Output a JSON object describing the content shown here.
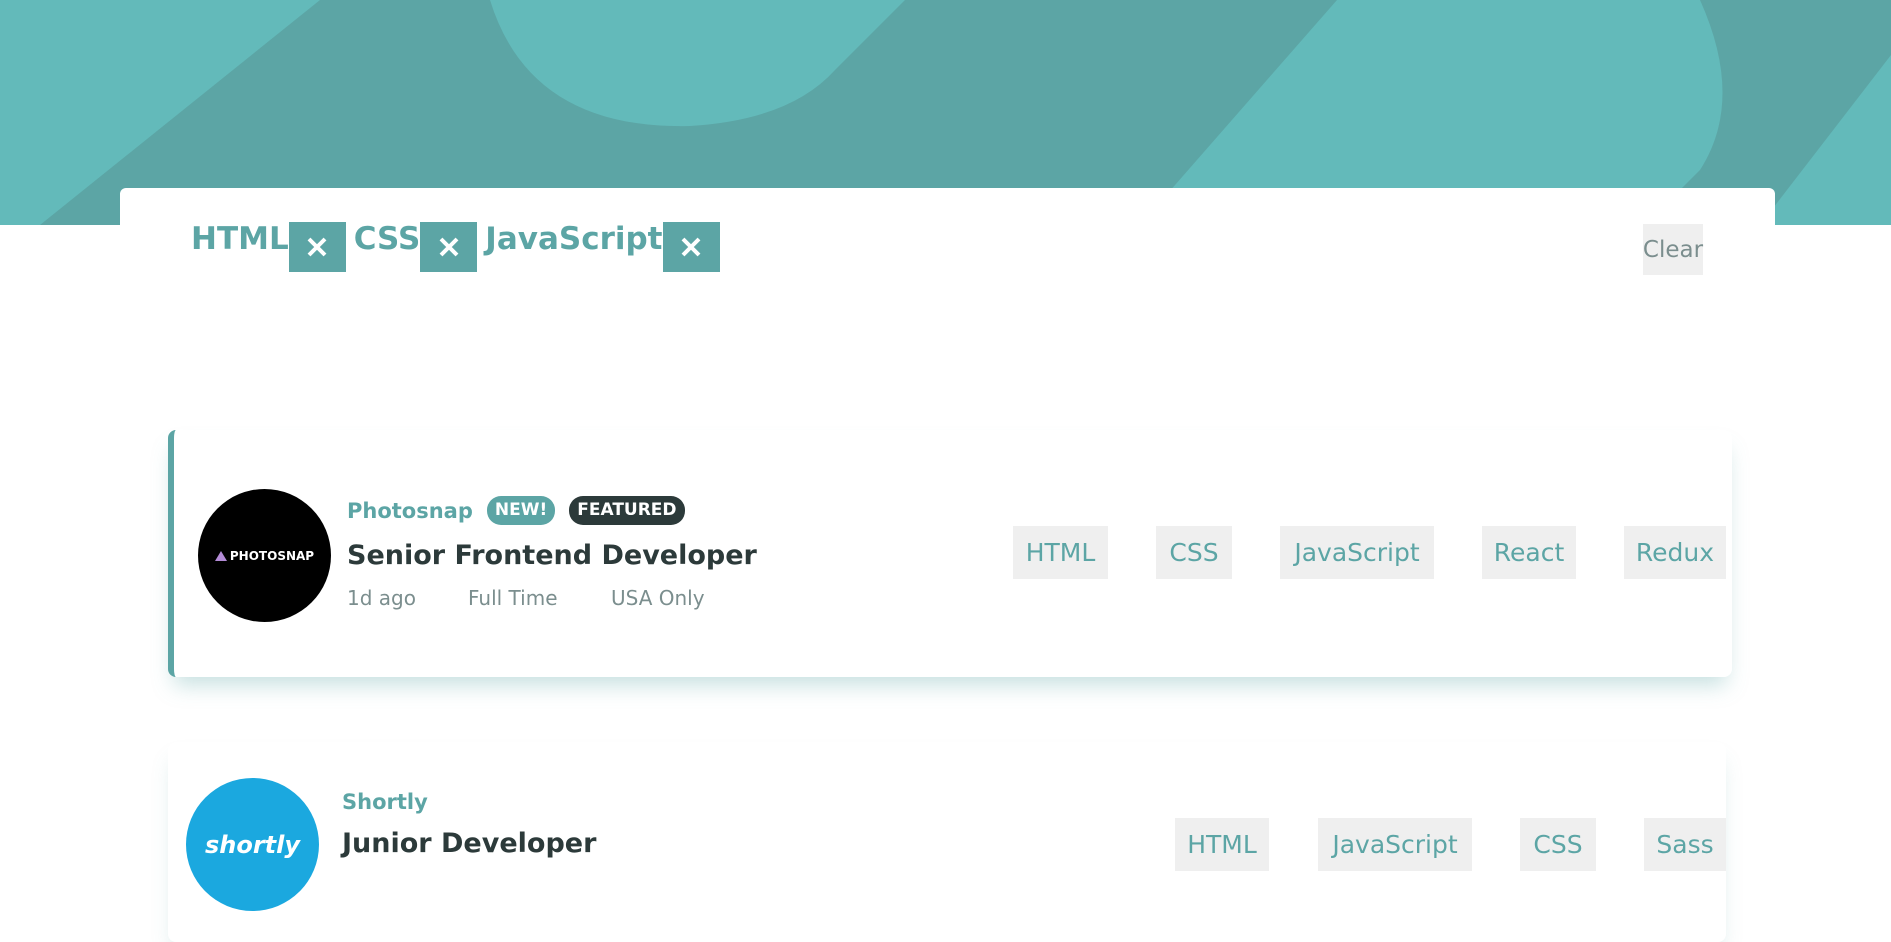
{
  "colors": {
    "accent": "#5ca5a5",
    "dark": "#2c3a3a",
    "muted": "#7b8e8e",
    "tag_bg": "#efefef"
  },
  "filter_bar": {
    "chips": [
      {
        "label": "HTML",
        "remove_icon": "close-icon"
      },
      {
        "label": "CSS",
        "remove_icon": "close-icon"
      },
      {
        "label": "JavaScript",
        "remove_icon": "close-icon"
      }
    ],
    "clear_label": "Clear"
  },
  "jobs": [
    {
      "company": "Photosnap",
      "logo_text": "PHOTOSNAP",
      "new_badge": "NEW!",
      "featured_badge": "FEATURED",
      "position": "Senior Frontend Developer",
      "posted": "1d ago",
      "contract": "Full Time",
      "location": "USA Only",
      "tags": [
        "HTML",
        "CSS",
        "JavaScript",
        "React",
        "Redux"
      ]
    },
    {
      "company": "Shortly",
      "logo_text": "shortly",
      "position": "Junior Developer",
      "tags": [
        "HTML",
        "JavaScript",
        "CSS",
        "Sass"
      ]
    }
  ]
}
